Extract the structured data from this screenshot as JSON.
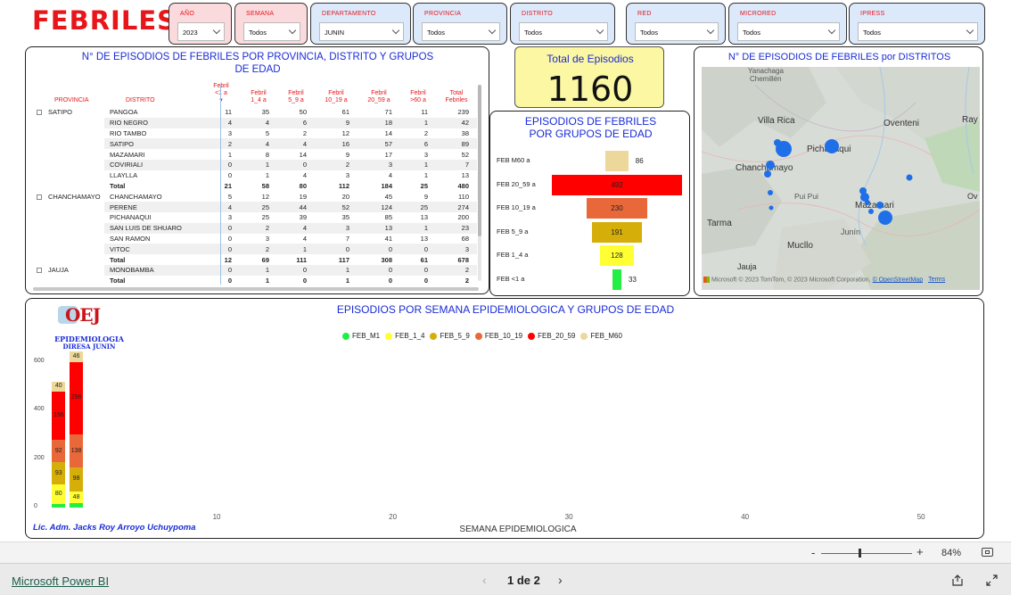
{
  "header": {
    "title": "FEBRILES"
  },
  "slicers": [
    {
      "label": "AÑO",
      "value": "2023"
    },
    {
      "label": "SEMANA",
      "value": "Todos"
    },
    {
      "label": "DEPARTAMENTO",
      "value": "JUNIN"
    },
    {
      "label": "PROVINCIA",
      "value": "Todos"
    },
    {
      "label": "DISTRITO",
      "value": "Todos"
    },
    {
      "label": "RED",
      "value": "Todos"
    },
    {
      "label": "MICRORED",
      "value": "Todos"
    },
    {
      "label": "IPRESS",
      "value": "Todos"
    }
  ],
  "matrix": {
    "title_line1": "N° DE EPISODIOS DE FEBRILES POR PROVINCIA, DISTRITO Y GRUPOS",
    "title_line2": "DE EDAD",
    "headers": {
      "provincia": "PROVINCIA",
      "distrito": "DISTRITO",
      "c1a": "Febril",
      "c1b": "<1 a",
      "c2a": "Febril",
      "c2b": "1_4 a",
      "c3a": "Febril",
      "c3b": "5_9 a",
      "c4a": "Febril",
      "c4b": "10_19 a",
      "c5a": "Febril",
      "c5b": "20_59 a",
      "c6a": "Febril",
      "c6b": ">60 a",
      "c7a": "Total",
      "c7b": "Febriles"
    },
    "rows": [
      {
        "prov": "SATIPO",
        "dist": "PANGOA",
        "v": [
          "11",
          "35",
          "50",
          "61",
          "71",
          "11",
          "239"
        ]
      },
      {
        "prov": "",
        "dist": "RIO NEGRO",
        "v": [
          "4",
          "4",
          "6",
          "9",
          "18",
          "1",
          "42"
        ]
      },
      {
        "prov": "",
        "dist": "RIO TAMBO",
        "v": [
          "3",
          "5",
          "2",
          "12",
          "14",
          "2",
          "38"
        ]
      },
      {
        "prov": "",
        "dist": "SATIPO",
        "v": [
          "2",
          "4",
          "4",
          "16",
          "57",
          "6",
          "89"
        ]
      },
      {
        "prov": "",
        "dist": "MAZAMARI",
        "v": [
          "1",
          "8",
          "14",
          "9",
          "17",
          "3",
          "52"
        ]
      },
      {
        "prov": "",
        "dist": "COVIRIALI",
        "v": [
          "0",
          "1",
          "0",
          "2",
          "3",
          "1",
          "7"
        ]
      },
      {
        "prov": "",
        "dist": "LLAYLLA",
        "v": [
          "0",
          "1",
          "4",
          "3",
          "4",
          "1",
          "13"
        ]
      },
      {
        "prov": "",
        "dist": "Total",
        "total": true,
        "v": [
          "21",
          "58",
          "80",
          "112",
          "184",
          "25",
          "480"
        ]
      },
      {
        "prov": "CHANCHAMAYO",
        "dist": "CHANCHAMAYO",
        "v": [
          "5",
          "12",
          "19",
          "20",
          "45",
          "9",
          "110"
        ]
      },
      {
        "prov": "",
        "dist": "PERENE",
        "v": [
          "4",
          "25",
          "44",
          "52",
          "124",
          "25",
          "274"
        ]
      },
      {
        "prov": "",
        "dist": "PICHANAQUI",
        "v": [
          "3",
          "25",
          "39",
          "35",
          "85",
          "13",
          "200"
        ]
      },
      {
        "prov": "",
        "dist": "SAN LUIS DE SHUARO",
        "v": [
          "0",
          "2",
          "4",
          "3",
          "13",
          "1",
          "23"
        ]
      },
      {
        "prov": "",
        "dist": "SAN RAMON",
        "v": [
          "0",
          "3",
          "4",
          "7",
          "41",
          "13",
          "68"
        ]
      },
      {
        "prov": "",
        "dist": "VITOC",
        "v": [
          "0",
          "2",
          "1",
          "0",
          "0",
          "0",
          "3"
        ]
      },
      {
        "prov": "",
        "dist": "Total",
        "total": true,
        "v": [
          "12",
          "69",
          "111",
          "117",
          "308",
          "61",
          "678"
        ]
      },
      {
        "prov": "JAUJA",
        "dist": "MONOBAMBA",
        "v": [
          "0",
          "1",
          "0",
          "1",
          "0",
          "0",
          "2"
        ]
      },
      {
        "prov": "",
        "dist": "Total",
        "total": true,
        "v": [
          "0",
          "1",
          "0",
          "1",
          "0",
          "0",
          "2"
        ]
      }
    ]
  },
  "card": {
    "title": "Total de Episodios",
    "value": "1160"
  },
  "funnel": {
    "title_line1": "EPISODIOS DE FEBRILES",
    "title_line2": "POR GRUPOS DE EDAD",
    "rows": [
      {
        "label": "FEB M60 a",
        "value": 86,
        "color": "#ecd89a"
      },
      {
        "label": "FEB 20_59 a",
        "value": 492,
        "color": "#ff0000"
      },
      {
        "label": "FEB 10_19 a",
        "value": 230,
        "color": "#e8683a"
      },
      {
        "label": "FEB 5_9 a",
        "value": 191,
        "color": "#d6ae0a"
      },
      {
        "label": "FEB 1_4 a",
        "value": 128,
        "color": "#ffff33"
      },
      {
        "label": "FEB <1 a",
        "value": 33,
        "color": "#22ee44"
      }
    ]
  },
  "map": {
    "title": "N° DE EPISODIOS DE FEBRILES por DISTRITOS",
    "place_labels": {
      "yanachaga": "Yanachaga",
      "chemillen": "Chemillén",
      "villa_rica": "Villa Rica",
      "oventeni": "Oventeni",
      "ray": "Ray",
      "pichanaqui": "Pichanaqui",
      "chanchamayo": "Chanchamayo",
      "pui_pui": "Pui Pui",
      "mazamari": "Mazamari",
      "ov": "Ov",
      "tarma": "Tarma",
      "junin": "Junín",
      "muclio": "Mucllo",
      "jauja": "Jauja"
    },
    "attribution": "Microsoft",
    "copyright": "© 2023 TomTom, © 2023 Microsoft Corporation,",
    "osm": "© OpenStreetMap",
    "terms": "Terms"
  },
  "weekly": {
    "title": "EPISODIOS POR SEMANA EPIDEMIOLOGICA Y GRUPOS DE EDAD",
    "legend": [
      {
        "name": "FEB_M1",
        "color": "#22ee44"
      },
      {
        "name": "FEB_1_4",
        "color": "#ffff33"
      },
      {
        "name": "FEB_5_9",
        "color": "#d6ae0a"
      },
      {
        "name": "FEB_10_19",
        "color": "#e8683a"
      },
      {
        "name": "FEB_20_59",
        "color": "#ff0000"
      },
      {
        "name": "FEB_M60",
        "color": "#ecd89a"
      }
    ],
    "xlabel": "SEMANA EPIDEMIOLOGICA",
    "author": "Lic. Adm. Jacks Roy Arroyo Uchuypoma",
    "logo_text_line1": "EPIDEMIOLOGIA",
    "logo_text_line2": "DIRESA JUNIN",
    "logo_letters": "OEJ"
  },
  "chart_data": {
    "type": "bar",
    "stacked": true,
    "title": "EPISODIOS POR SEMANA EPIDEMIOLOGICA Y GRUPOS DE EDAD",
    "xlabel": "SEMANA EPIDEMIOLOGICA",
    "ylabel": "",
    "x": [
      1,
      2
    ],
    "x_ticks": [
      "10",
      "20",
      "30",
      "40",
      "50"
    ],
    "y_ticks": [
      "0",
      "200",
      "400",
      "600"
    ],
    "ylim": [
      0,
      650
    ],
    "xlim": [
      0.3,
      53
    ],
    "series": [
      {
        "name": "FEB_M1",
        "values": [
          15,
          18
        ]
      },
      {
        "name": "FEB_1_4",
        "values": [
          80,
          48
        ]
      },
      {
        "name": "FEB_5_9",
        "values": [
          93,
          98
        ]
      },
      {
        "name": "FEB_10_19",
        "values": [
          92,
          138
        ]
      },
      {
        "name": "FEB_20_59",
        "values": [
          196,
          296
        ]
      },
      {
        "name": "FEB_M60",
        "values": [
          40,
          46
        ]
      }
    ],
    "labels": [
      [
        "",
        "80",
        "93",
        "92",
        "196",
        "40"
      ],
      [
        "",
        "48",
        "98",
        "138",
        "296",
        "46"
      ]
    ],
    "legend_position": "top"
  },
  "footer": {
    "zoom_minus": "-",
    "zoom_plus": "+",
    "zoom": "84%",
    "zoom_level": 0.6,
    "brand": "Microsoft Power BI",
    "page": "1 de 2"
  }
}
